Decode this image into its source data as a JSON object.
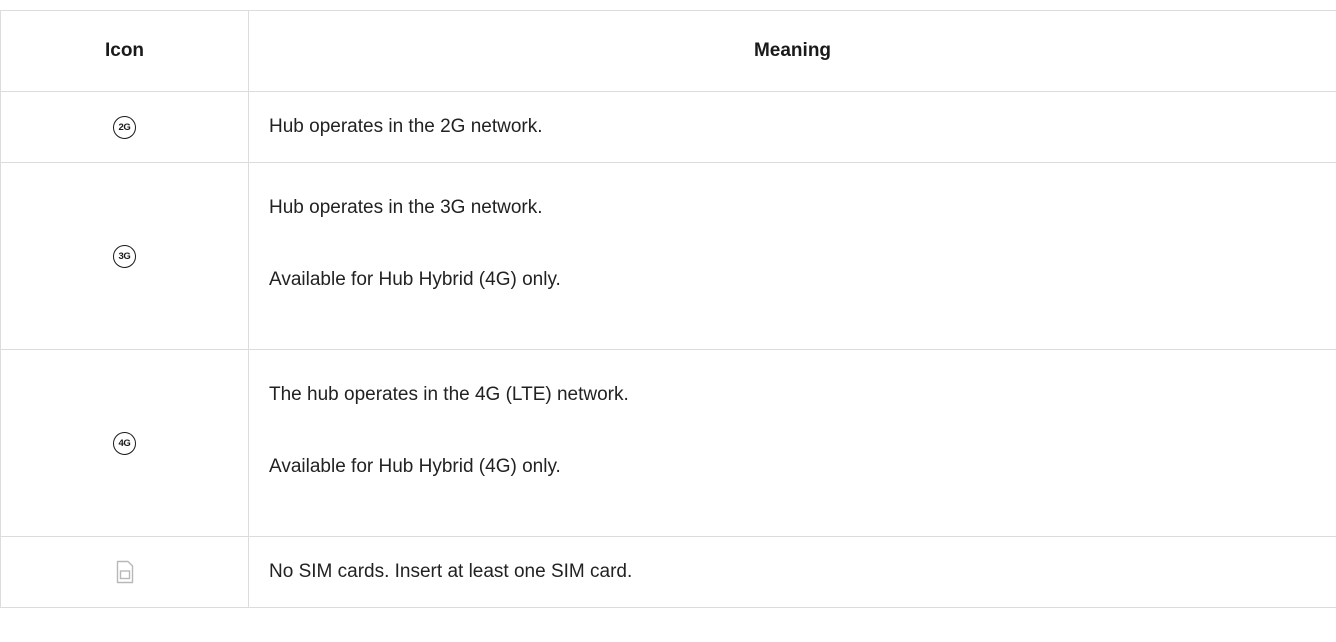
{
  "table": {
    "headers": {
      "icon": "Icon",
      "meaning": "Meaning"
    },
    "rows": [
      {
        "icon_name": "2g-network-icon",
        "icon_text": "2G",
        "meaning": [
          "Hub operates in the 2G network."
        ]
      },
      {
        "icon_name": "3g-network-icon",
        "icon_text": "3G",
        "meaning": [
          "Hub operates in the 3G network.",
          "Available for Hub Hybrid (4G) only."
        ]
      },
      {
        "icon_name": "4g-network-icon",
        "icon_text": "4G",
        "meaning": [
          "The hub operates in the 4G (LTE) network.",
          "Available for Hub Hybrid (4G) only."
        ]
      },
      {
        "icon_name": "no-sim-card-icon",
        "icon_text": "",
        "meaning": [
          "No SIM cards. Insert at least one SIM card."
        ]
      }
    ]
  },
  "colors": {
    "border": "#dcdcdc",
    "text": "#222222",
    "icon_dark": "#1a1a1a",
    "icon_muted": "#b8b8b8"
  }
}
